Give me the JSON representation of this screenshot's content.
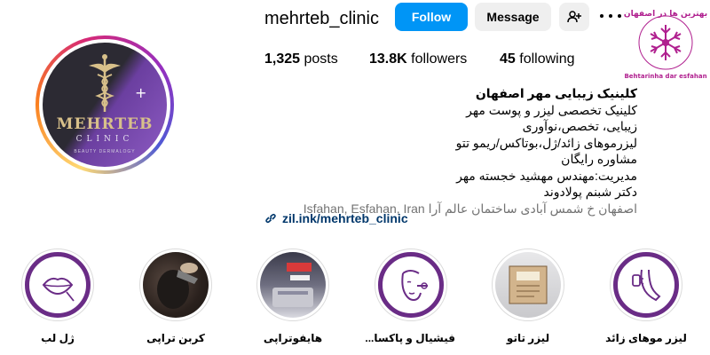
{
  "profile": {
    "username": "mehrteb_clinic",
    "logo_name": "MEHRTEB",
    "logo_clinic": "CLINIC",
    "logo_sub": "BEAUTY   DERMALOGY"
  },
  "actions": {
    "follow_label": "Follow",
    "message_label": "Message"
  },
  "stats": {
    "posts_count": "1,325",
    "posts_label": "posts",
    "followers_count": "13.8K",
    "followers_label": "followers",
    "following_count": "45",
    "following_label": "following"
  },
  "bio": {
    "name": "کلینیک زیبایی مهر اصفهان",
    "lines": [
      "کلینیک تخصصی لیزر و پوست مهر",
      "زیبایی، تخصص،نوآوری",
      "لیزرموهای زائد/ژل،بوتاکس/ریمو تتو",
      "مشاوره رایگان",
      "مدیریت:مهندس مهشید خجسته مهر",
      "دکتر شبنم پولادوند"
    ],
    "location": "Isfahan, Esfahan, Iran",
    "address": "اصفهان خ شمس آبادی ساختمان عالم آرا",
    "link": "zil.ink/mehrteb_clinic"
  },
  "badge": {
    "top_text": "بهترین ها در اصفهان",
    "bottom_text": "Behtarinha dar esfahan"
  },
  "highlights": [
    {
      "label": "ژل لب",
      "icon": "lips-icon"
    },
    {
      "label": "کربن تراپی",
      "icon": "carbon-therapy-photo"
    },
    {
      "label": "هایفوتراپی",
      "icon": "hifu-photo"
    },
    {
      "label": "فیشیال و پاکسا...",
      "icon": "facial-icon"
    },
    {
      "label": "لیزر تاتو",
      "icon": "laser-tattoo-photo"
    },
    {
      "label": "لیزر موهای زائد",
      "icon": "leg-laser-icon"
    }
  ],
  "colors": {
    "follow_blue": "#0095f6",
    "button_gray": "#efefef",
    "highlight_purple": "#6a2c86",
    "link_blue": "#00376b"
  }
}
